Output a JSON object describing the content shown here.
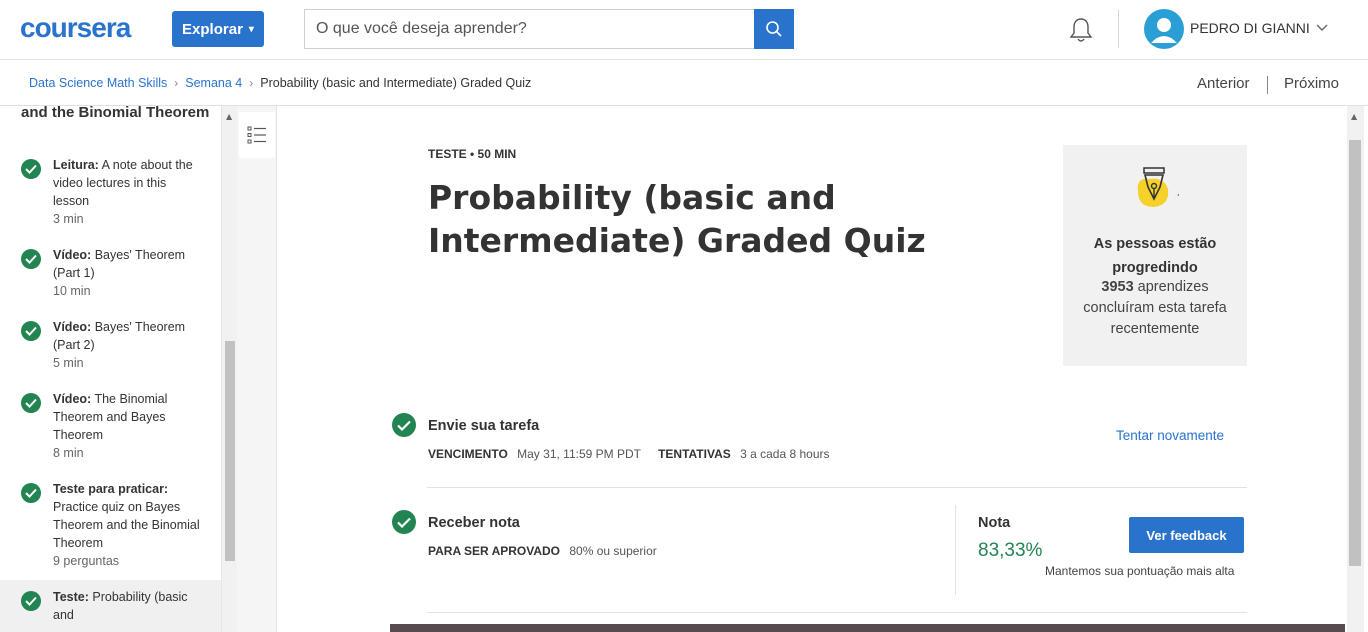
{
  "header": {
    "logo": "coursera",
    "explore_label": "Explorar",
    "search_placeholder": "O que você deseja aprender?",
    "user_name": "PEDRO DI GIANNI"
  },
  "breadcrumb": {
    "items": [
      "Data Science Math Skills",
      "Semana 4",
      "Probability (basic and Intermediate) Graded Quiz"
    ],
    "prev_label": "Anterior",
    "next_label": "Próximo"
  },
  "sidebar": {
    "heading": "and the Binomial Theorem",
    "items": [
      {
        "type": "Leitura:",
        "title": "A note about the video lectures in this lesson",
        "meta": "3 min"
      },
      {
        "type": "Vídeo:",
        "title": "Bayes' Theorem (Part 1)",
        "meta": "10 min"
      },
      {
        "type": "Vídeo:",
        "title": "Bayes' Theorem (Part 2)",
        "meta": "5 min"
      },
      {
        "type": "Vídeo:",
        "title": "The Binomial Theorem and Bayes Theorem",
        "meta": "8 min"
      },
      {
        "type": "Teste para praticar:",
        "title": "Practice quiz on Bayes Theorem and the Binomial Theorem",
        "meta": "9 perguntas"
      },
      {
        "type": "Teste:",
        "title": "Probability (basic and",
        "meta": ""
      }
    ]
  },
  "quiz": {
    "meta": "TESTE • 50 MIN",
    "title": "Probability (basic and Intermediate) Graded Quiz"
  },
  "progress_card": {
    "title": "As pessoas estão progredindo",
    "count": "3953",
    "text": "aprendizes concluíram esta tarefa recentemente"
  },
  "submit": {
    "title": "Envie sua tarefa",
    "due_label": "VENCIMENTO",
    "due_value": "May 31, 11:59 PM PDT",
    "attempts_label": "TENTATIVAS",
    "attempts_value": "3 a cada 8 hours",
    "retry_label": "Tentar novamente"
  },
  "grade": {
    "title": "Receber nota",
    "pass_label": "PARA SER APROVADO",
    "pass_value": "80% ou superior",
    "grade_label": "Nota",
    "grade_value": "83,33%",
    "feedback_label": "Ver feedback",
    "note": "Mantemos sua pontuação mais alta"
  },
  "colors": {
    "brand_blue": "#2a73cc",
    "success_green": "#218451",
    "avatar_blue": "#2a9fd6",
    "badge_yellow": "#f5d12a"
  },
  "icons": [
    "search-icon",
    "bell-icon",
    "user-avatar-icon",
    "chevron-down-icon",
    "list-icon",
    "check-icon",
    "pen-nib-icon"
  ]
}
